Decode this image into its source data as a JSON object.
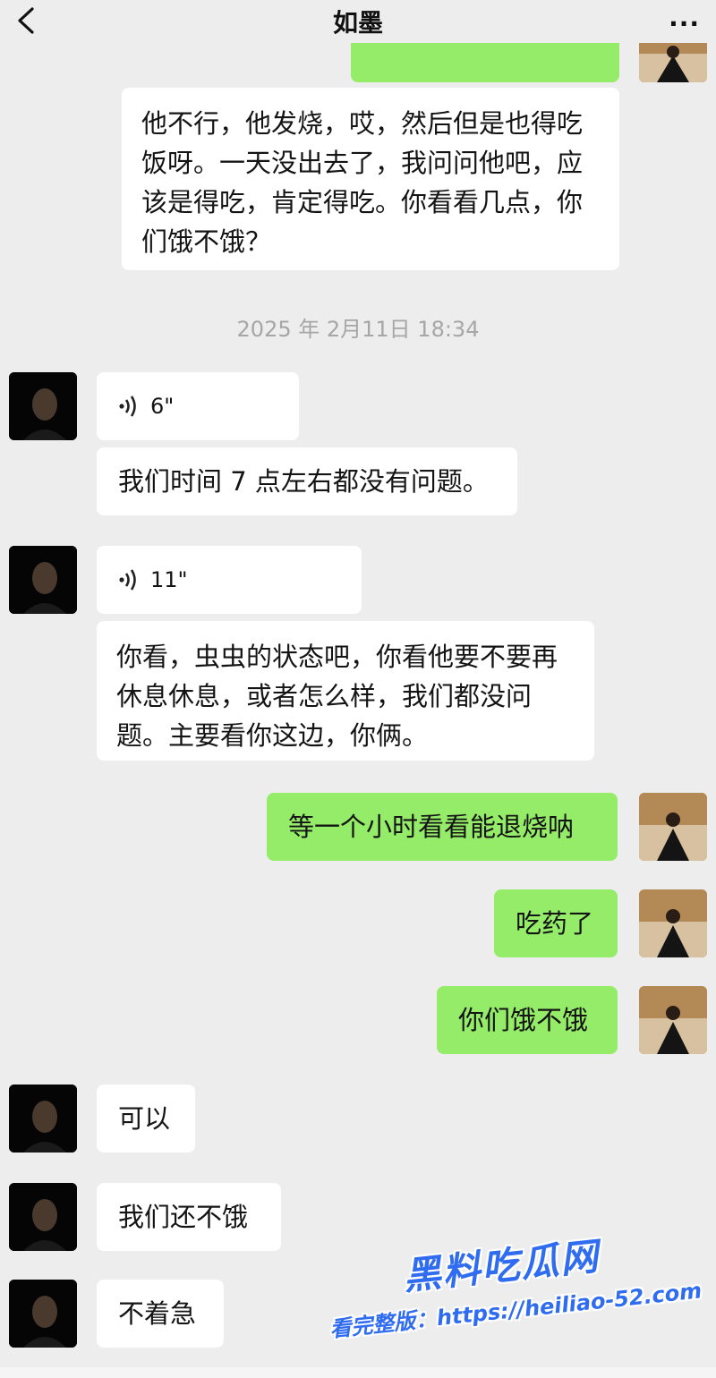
{
  "header": {
    "title": "如墨",
    "more_label": "···"
  },
  "colors": {
    "sent_bubble": "#95ec69",
    "received_bubble": "#ffffff",
    "background": "#ededed"
  },
  "messages": {
    "m1": "他不行，他发烧，哎，然后但是也得吃饭呀。一天没出去了，我问问他吧，应该是得吃，肯定得吃。你看看几点，你们饿不饿？",
    "timestamp": "2025 年 2月11日 18:34",
    "v1": "6\"",
    "m2": "我们时间 7 点左右都没有问题。",
    "v2": "11\"",
    "m3": "你看，虫虫的状态吧，你看他要不要再休息休息，或者怎么样，我们都没问题。主要看你这边，你俩。",
    "m4": "等一个小时看看能退烧呐",
    "m5": "吃药了",
    "m6": "你们饿不饿",
    "m7": "可以",
    "m8": "我们还不饿",
    "m9": "不着急"
  },
  "watermark": {
    "title": "黑料吃瓜网",
    "url": "看完整版：https://heiliao-52.com"
  }
}
